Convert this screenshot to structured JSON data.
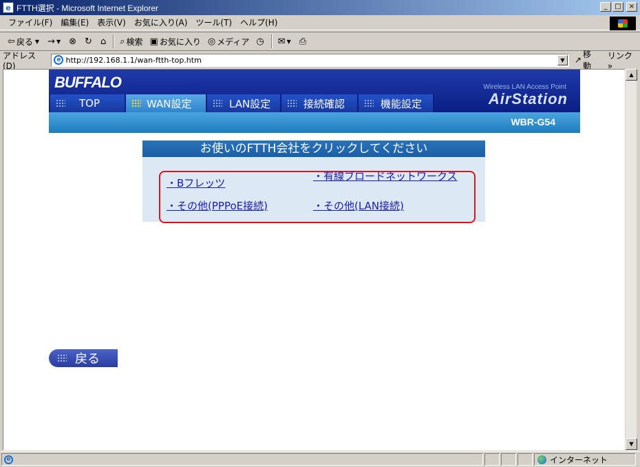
{
  "window": {
    "title": "FTTH選択 - Microsoft Internet Explorer",
    "controls": {
      "minimize": "_",
      "maximize": "□",
      "close": "×"
    }
  },
  "menu": [
    "ファイル(F)",
    "編集(E)",
    "表示(V)",
    "お気に入り(A)",
    "ツール(T)",
    "ヘルプ(H)"
  ],
  "toolbar": {
    "back": "戻る",
    "forward": "→",
    "stop": "⊗",
    "refresh": "↻",
    "home": "⌂",
    "search": "検索",
    "favorites": "お気に入り",
    "media": "メディア"
  },
  "address": {
    "label": "アドレス(D)",
    "url": "http://192.168.1.1/wan-ftth-top.htm",
    "go": "移動",
    "links": "リンク »"
  },
  "header": {
    "logo": "BUFFALO",
    "tagline_small": "Wireless LAN Access Point",
    "tagline_big": "AirStation",
    "model": "WBR-G54",
    "tabs": [
      {
        "label": "TOP"
      },
      {
        "label": "WAN設定"
      },
      {
        "label": "LAN設定"
      },
      {
        "label": "接続確認"
      },
      {
        "label": "機能設定"
      }
    ],
    "active_tab": "WAN設定"
  },
  "panel": {
    "title": "お使いのFTTH会社をクリックしてください",
    "options": [
      "・Bフレッツ",
      "・有線ブロードネットワークス",
      "・その他(PPPoE接続)",
      "・その他(LAN接続)"
    ]
  },
  "back_button": {
    "label": "戻る"
  },
  "status": {
    "zone": "インターネット"
  },
  "colors": {
    "accent_red": "#d9141a",
    "link": "#1a1ab0",
    "header_blue": "#0a1e85"
  }
}
